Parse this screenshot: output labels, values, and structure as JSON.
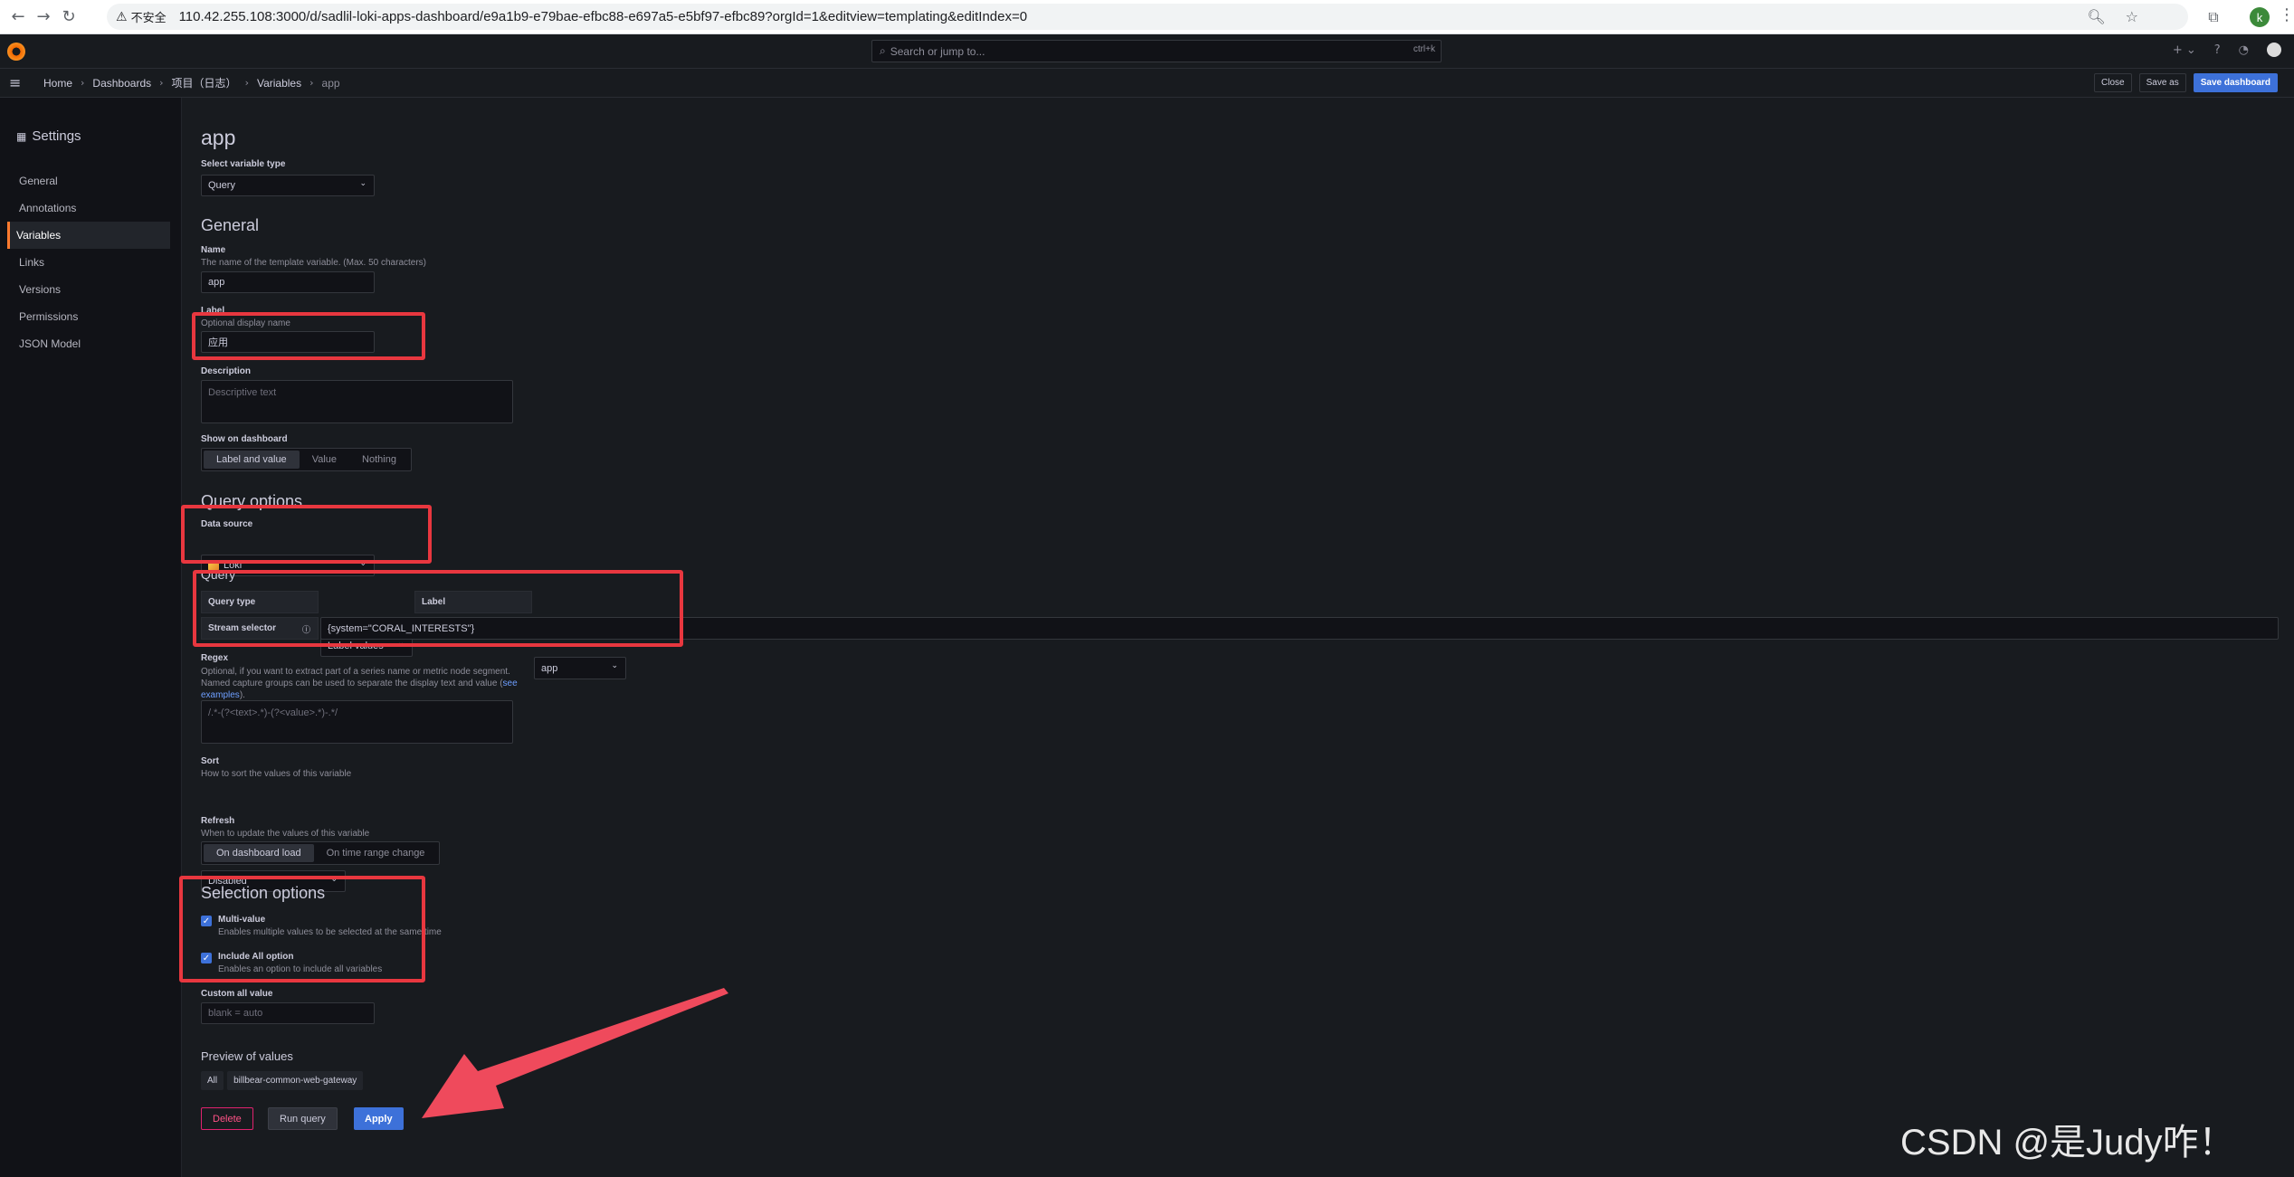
{
  "browser": {
    "security_label": "不安全",
    "url": "110.42.255.108:3000/d/sadlil-loki-apps-dashboard/e9a1b9-e79bae-efbc88-e697a5-e5bf97-efbc89?orgId=1&editview=templating&editIndex=0",
    "profile_initial": "k"
  },
  "topbar": {
    "search_placeholder": "Search or jump to...",
    "search_shortcut": "ctrl+k",
    "plus_label": "+ ⌄"
  },
  "breadcrumb": {
    "items": [
      "Home",
      "Dashboards",
      "项目（日志）",
      "Variables",
      "app"
    ]
  },
  "toolbar": {
    "close_label": "Close",
    "save_as_label": "Save as",
    "save_dashboard_label": "Save dashboard"
  },
  "sidebar": {
    "title": "Settings",
    "items": [
      {
        "label": "General",
        "active": false
      },
      {
        "label": "Annotations",
        "active": false
      },
      {
        "label": "Variables",
        "active": true
      },
      {
        "label": "Links",
        "active": false
      },
      {
        "label": "Versions",
        "active": false
      },
      {
        "label": "Permissions",
        "active": false
      },
      {
        "label": "JSON Model",
        "active": false
      }
    ]
  },
  "form": {
    "title": "app",
    "variable_type": {
      "label": "Select variable type",
      "value": "Query"
    },
    "general_heading": "General",
    "name": {
      "label": "Name",
      "description": "The name of the template variable. (Max. 50 characters)",
      "value": "app"
    },
    "label_field": {
      "label": "Label",
      "description": "Optional display name",
      "value": "应用"
    },
    "description": {
      "label": "Description",
      "placeholder": "Descriptive text"
    },
    "show_on_dashboard": {
      "label": "Show on dashboard",
      "options": [
        "Label and value",
        "Value",
        "Nothing"
      ],
      "selected": "Label and value"
    },
    "query_options_heading": "Query options",
    "data_source": {
      "label": "Data source",
      "value": "Loki"
    },
    "query_heading": "Query",
    "query_type": {
      "label": "Query type",
      "value": "Label values"
    },
    "query_label": {
      "label": "Label",
      "value": "app"
    },
    "stream_selector": {
      "label": "Stream selector",
      "value": "{system=\"CORAL_INTERESTS\"}"
    },
    "regex": {
      "label": "Regex",
      "description_1": "Optional, if you want to extract part of a series name or metric node segment.",
      "description_2": "Named capture groups can be used to separate the display text and value (",
      "link_text_1": "see",
      "link_text_2": "examples",
      "description_end": ").",
      "placeholder": "/.*-(?<text>.*)-(?<value>.*)-.*/"
    },
    "sort": {
      "label": "Sort",
      "description": "How to sort the values of this variable",
      "value": "Disabled"
    },
    "refresh": {
      "label": "Refresh",
      "description": "When to update the values of this variable",
      "options": [
        "On dashboard load",
        "On time range change"
      ],
      "selected": "On dashboard load"
    },
    "selection_heading": "Selection options",
    "multi_value": {
      "label": "Multi-value",
      "description": "Enables multiple values to be selected at the same time",
      "checked": true
    },
    "include_all": {
      "label": "Include All option",
      "description": "Enables an option to include all variables",
      "checked": true
    },
    "custom_all": {
      "label": "Custom all value",
      "placeholder": "blank = auto"
    },
    "preview_heading": "Preview of values",
    "preview_values": [
      "All",
      "billbear-common-web-gateway"
    ],
    "delete_label": "Delete",
    "run_query_label": "Run query",
    "apply_label": "Apply"
  },
  "annotation_color": "#e8373f",
  "watermark": "CSDN @是Judy咋！"
}
